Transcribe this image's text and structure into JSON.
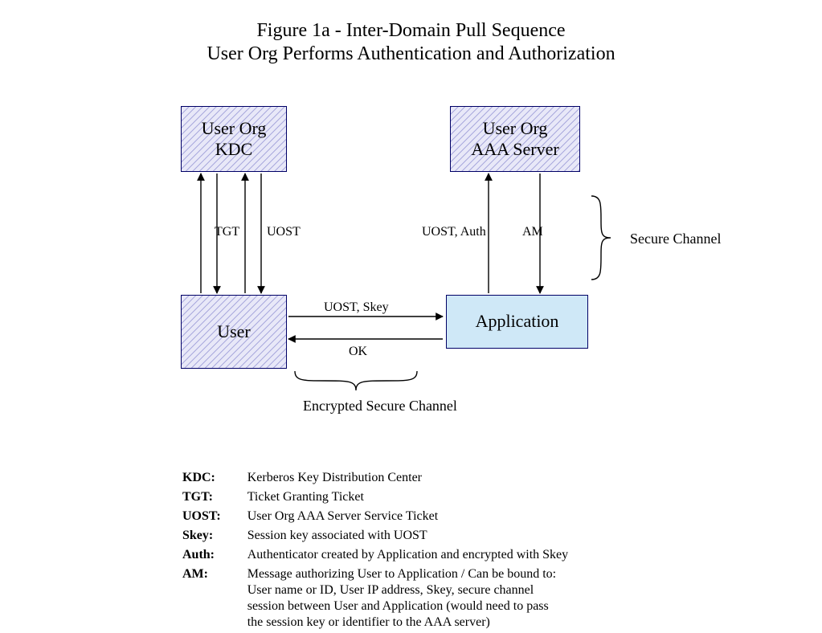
{
  "title": {
    "line1": "Figure 1a - Inter-Domain Pull Sequence",
    "line2": "User Org Performs Authentication and Authorization"
  },
  "boxes": {
    "kdc": "User Org\nKDC",
    "aaa": "User Org\nAAA Server",
    "user": "User",
    "app": "Application"
  },
  "edge_labels": {
    "tgt": "TGT",
    "uost": "UOST",
    "uost_auth": "UOST, Auth",
    "am": "AM",
    "uost_skey": "UOST,  Skey",
    "ok": "OK"
  },
  "annotations": {
    "secure_channel": "Secure Channel",
    "encrypted_secure_channel": "Encrypted Secure Channel"
  },
  "glossary": [
    {
      "term": "KDC:",
      "def": "Kerberos Key Distribution Center"
    },
    {
      "term": "TGT:",
      "def": "Ticket Granting Ticket"
    },
    {
      "term": "UOST:",
      "def": "User Org AAA Server Service Ticket"
    },
    {
      "term": "Skey:",
      "def": "Session key associated with UOST"
    },
    {
      "term": "Auth:",
      "def": "Authenticator created by Application and encrypted with Skey"
    },
    {
      "term": "AM:",
      "def": "Message authorizing User to Application / Can be bound to:\nUser name or ID, User IP address, Skey, secure channel\nsession between User and Application (would need to pass\nthe session key or identifier to the AAA server)"
    }
  ]
}
